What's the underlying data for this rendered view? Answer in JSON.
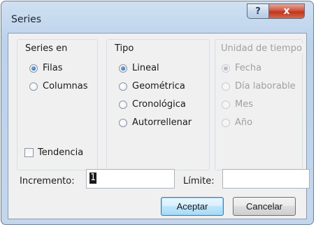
{
  "window": {
    "title": "Series",
    "help_label": "?",
    "close_label": "x"
  },
  "series_en": {
    "legend": "Series en",
    "options": [
      {
        "label": "Filas",
        "checked": true
      },
      {
        "label": "Columnas",
        "checked": false
      }
    ]
  },
  "tipo": {
    "legend": "Tipo",
    "options": [
      {
        "label": "Lineal",
        "checked": true
      },
      {
        "label": "Geométrica",
        "checked": false
      },
      {
        "label": "Cronológica",
        "checked": false
      },
      {
        "label": "Autorrellenar",
        "checked": false
      }
    ]
  },
  "unidad": {
    "legend": "Unidad de tiempo",
    "enabled": false,
    "options": [
      {
        "label": "Fecha",
        "checked": true
      },
      {
        "label": "Día laborable",
        "checked": false
      },
      {
        "label": "Mes",
        "checked": false
      },
      {
        "label": "Año",
        "checked": false
      }
    ]
  },
  "tendencia": {
    "label": "Tendencia",
    "checked": false
  },
  "incremento": {
    "label": "Incremento:",
    "value": "1"
  },
  "limite": {
    "label": "Límite:",
    "value": ""
  },
  "buttons": {
    "ok": "Aceptar",
    "cancel": "Cancelar"
  }
}
